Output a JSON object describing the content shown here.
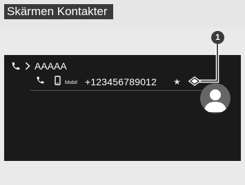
{
  "page": {
    "title": "Skärmen Kontakter"
  },
  "breadcrumb": {
    "contact_name": "AAAAA"
  },
  "contact_row": {
    "type_label": "Mobil",
    "number": "+123456789012",
    "star": "★"
  },
  "callout": {
    "number": "1"
  },
  "icons": {
    "breadcrumb_phone": "phone-icon",
    "breadcrumb_chevron": "chevron-right-icon",
    "row_call": "phone-icon",
    "row_type": "mobile-phone-icon",
    "favorite": "star-icon",
    "avatar": "person-icon"
  },
  "colors": {
    "screen_background": "#1a1a1a",
    "page_background": "#eaeaea",
    "title_tab": "#3a3a3a",
    "avatar": "#666666"
  }
}
